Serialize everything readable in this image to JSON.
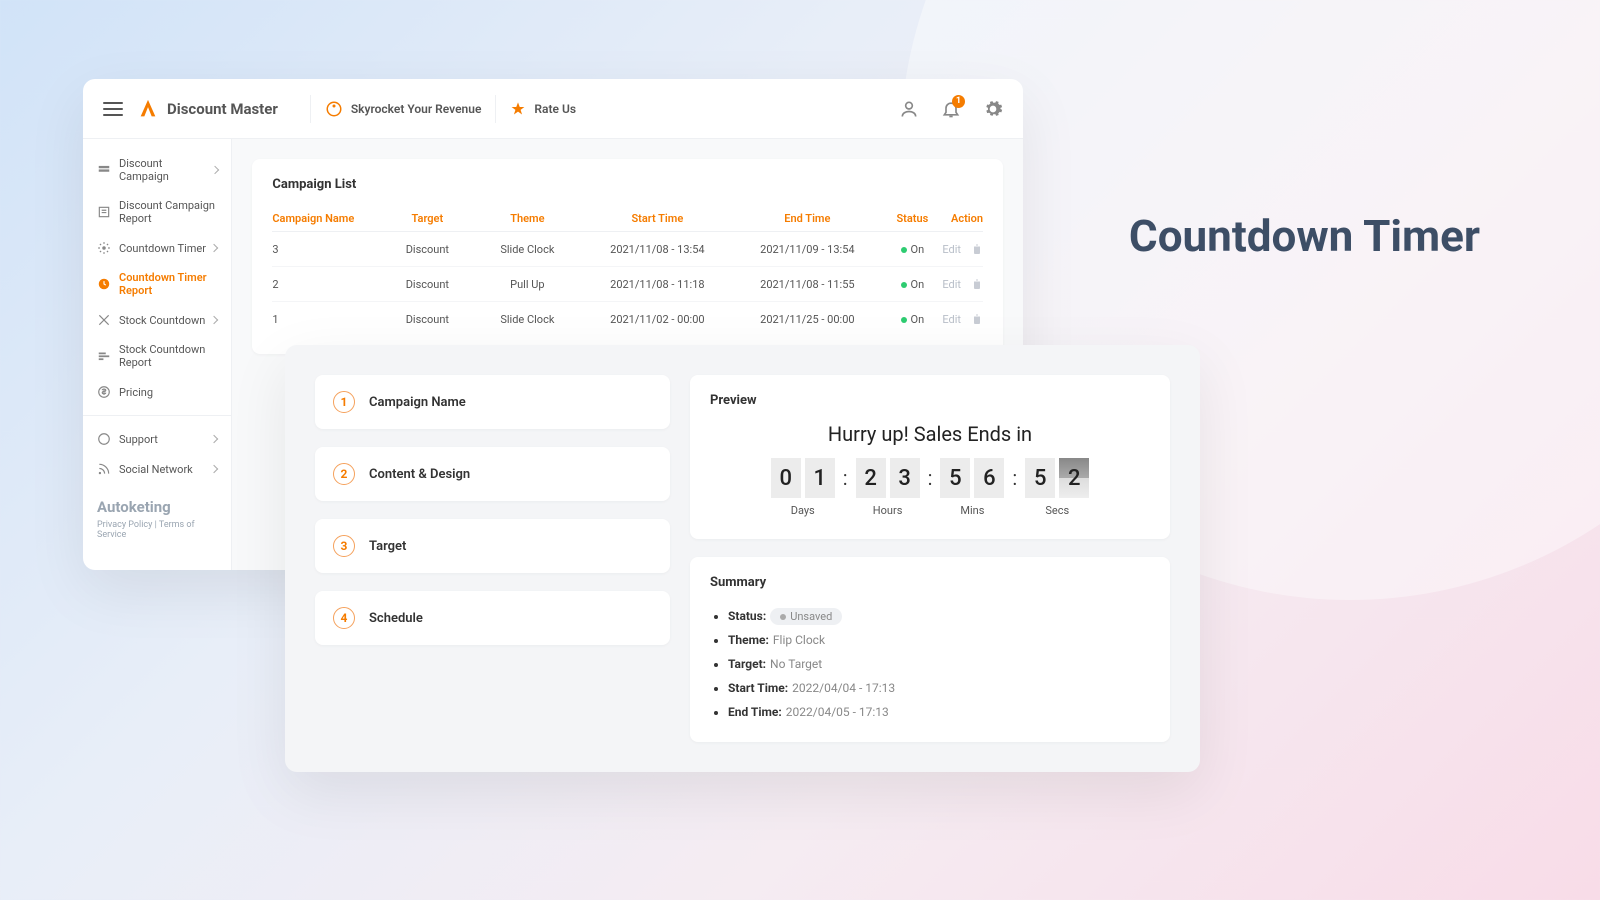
{
  "hero": {
    "title": "Countdown Timer"
  },
  "topbar": {
    "brand": "Discount Master",
    "skyrocket": "Skyrocket Your Revenue",
    "rate": "Rate Us",
    "notif_count": "1"
  },
  "sidebar": {
    "items": [
      {
        "label": "Discount Campaign",
        "chev": true
      },
      {
        "label": "Discount Campaign Report",
        "chev": false
      },
      {
        "label": "Countdown Timer",
        "chev": true
      },
      {
        "label": "Countdown Timer Report",
        "chev": false,
        "active": true
      },
      {
        "label": "Stock Countdown",
        "chev": true
      },
      {
        "label": "Stock Countdown Report",
        "chev": false
      },
      {
        "label": "Pricing",
        "chev": false
      }
    ],
    "items2": [
      {
        "label": "Support",
        "chev": true
      },
      {
        "label": "Social Network",
        "chev": true
      }
    ],
    "footer_brand": "Autoketing",
    "footer_legal": "Privacy Policy | Terms of Service"
  },
  "campaign_list": {
    "title": "Campaign List",
    "headers": {
      "name": "Campaign Name",
      "target": "Target",
      "theme": "Theme",
      "start": "Start Time",
      "end": "End Time",
      "status": "Status",
      "action": "Action"
    },
    "rows": [
      {
        "name": "3",
        "target": "Discount",
        "theme": "Slide Clock",
        "start": "2021/11/08 - 13:54",
        "end": "2021/11/09 - 13:54",
        "status": "On",
        "edit": "Edit"
      },
      {
        "name": "2",
        "target": "Discount",
        "theme": "Pull Up",
        "start": "2021/11/08 - 11:18",
        "end": "2021/11/08 - 11:55",
        "status": "On",
        "edit": "Edit"
      },
      {
        "name": "1",
        "target": "Discount",
        "theme": "Slide Clock",
        "start": "2021/11/02 - 00:00",
        "end": "2021/11/25 - 00:00",
        "status": "On",
        "edit": "Edit"
      }
    ]
  },
  "steps": [
    {
      "num": "1",
      "label": "Campaign Name"
    },
    {
      "num": "2",
      "label": "Content & Design"
    },
    {
      "num": "3",
      "label": "Target"
    },
    {
      "num": "4",
      "label": "Schedule"
    }
  ],
  "preview": {
    "title": "Preview",
    "hurry": "Hurry up! Sales Ends in",
    "days": {
      "d1": "0",
      "d2": "1",
      "label": "Days"
    },
    "hours": {
      "d1": "2",
      "d2": "3",
      "label": "Hours"
    },
    "mins": {
      "d1": "5",
      "d2": "6",
      "label": "Mins"
    },
    "secs": {
      "d1": "5",
      "d2": "2",
      "label": "Secs"
    }
  },
  "summary": {
    "title": "Summary",
    "status_k": "Status:",
    "status_v": "Unsaved",
    "theme_k": "Theme:",
    "theme_v": "Flip Clock",
    "target_k": "Target:",
    "target_v": "No Target",
    "start_k": "Start Time:",
    "start_v": "2022/04/04 - 17:13",
    "end_k": "End Time:",
    "end_v": "2022/04/05 - 17:13"
  }
}
